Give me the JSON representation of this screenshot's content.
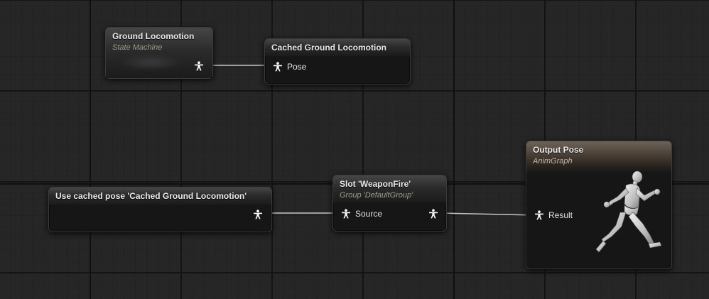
{
  "graph": {
    "nodes": {
      "ground_locomotion": {
        "title": "Ground Locomotion",
        "subtitle": "State Machine"
      },
      "cached_ground_locomotion": {
        "title": "Cached Ground Locomotion",
        "pin_label": "Pose"
      },
      "use_cached_pose": {
        "title": "Use cached pose 'Cached Ground Locomotion'"
      },
      "slot_weaponfire": {
        "title": "Slot 'WeaponFire'",
        "subtitle": "Group 'DefaultGroup'",
        "pin_label": "Source"
      },
      "output_pose": {
        "title": "Output Pose",
        "subtitle": "AnimGraph",
        "pin_label": "Result"
      }
    }
  },
  "icons": {
    "pose_pin": "person-pose-icon",
    "mannequin": "running-mannequin-icon"
  },
  "colors": {
    "background": "#262626",
    "wire": "#c8c8c8",
    "node_body": "#161616",
    "output_header": "#6e6357"
  }
}
